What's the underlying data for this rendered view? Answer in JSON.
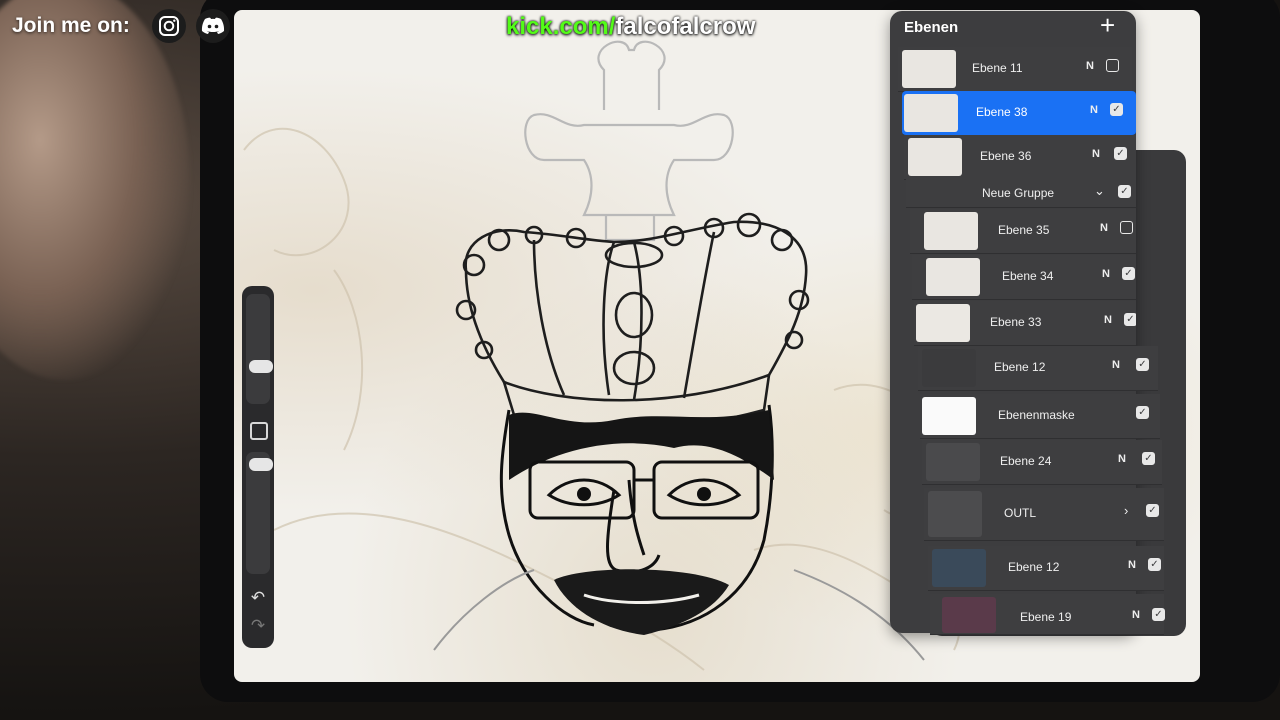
{
  "overlay": {
    "join_text": "Join me on:",
    "instagram_icon": "instagram-icon",
    "discord_icon": "discord-icon",
    "kick_domain": "kick.com/",
    "kick_user": "falcofalcrow",
    "kick_color": "#53fc18"
  },
  "toolbar": {
    "undo_icon": "↶",
    "redo_icon": "↷"
  },
  "layers_panel": {
    "title": "Ebenen",
    "add_icon": "+",
    "layers": [
      {
        "name": "Ebene 11",
        "mode": "N",
        "checked": false
      },
      {
        "name": "Ebene 38",
        "mode": "N",
        "checked": true,
        "selected": true
      },
      {
        "name": "Ebene 36",
        "mode": "N",
        "checked": true
      },
      {
        "name": "Neue Gruppe",
        "mode": "",
        "checked": true,
        "group": true
      },
      {
        "name": "Ebene 35",
        "mode": "N",
        "checked": false
      },
      {
        "name": "Ebene 34",
        "mode": "N",
        "checked": true
      },
      {
        "name": "Ebene 33",
        "mode": "N",
        "checked": true
      },
      {
        "name": "Ebene 12",
        "mode": "N",
        "checked": true
      },
      {
        "name": "Ebenenmaske",
        "mode": "",
        "checked": true
      },
      {
        "name": "Ebene 24",
        "mode": "N",
        "checked": true
      },
      {
        "name": "OUTL",
        "mode": "",
        "checked": true,
        "group": true
      },
      {
        "name": "Ebene 12",
        "mode": "N",
        "checked": true
      },
      {
        "name": "Ebene 19",
        "mode": "N",
        "checked": true
      }
    ]
  },
  "colors": {
    "selection": "#1a71f4",
    "panel_bg": "#3d3d3f"
  }
}
